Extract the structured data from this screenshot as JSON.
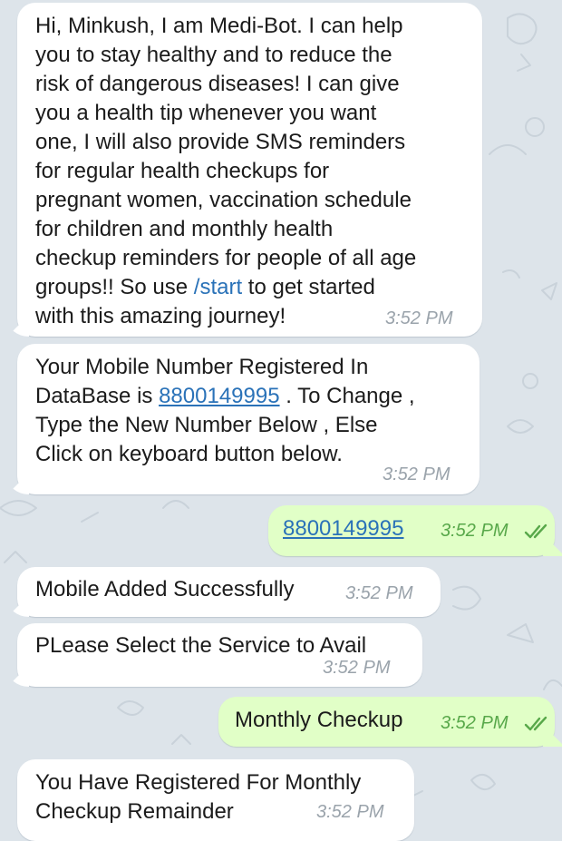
{
  "chat": {
    "messages": [
      {
        "direction": "incoming",
        "text_lines": [
          "Hi, Minkush, I am Medi-Bot. I can help",
          "you to stay healthy and to reduce the",
          "risk of dangerous diseases! I can give",
          "you a health tip whenever you want",
          "one, I will also provide SMS reminders",
          "for regular health checkups for",
          "pregnant women, vaccination schedule",
          "for children and monthly health",
          "checkup reminders for people of all age"
        ],
        "line10_before": "groups!! So use ",
        "command": "/start",
        "line10_after": " to get started",
        "line11": "with this amazing journey!",
        "time": "3:52 PM"
      },
      {
        "direction": "incoming",
        "line1": "Your Mobile Number Registered In",
        "line2_before": "DataBase is ",
        "phone": "8800149995",
        "line2_after": " . To Change ,",
        "line3": "Type the New Number Below , Else",
        "line4": "Click on keyboard button below.",
        "time": "3:52 PM"
      },
      {
        "direction": "outgoing",
        "phone": "8800149995",
        "time": "3:52 PM",
        "status": "read"
      },
      {
        "direction": "incoming",
        "text": "Mobile Added Successfully",
        "time": "3:52 PM"
      },
      {
        "direction": "incoming",
        "text": "PLease Select the Service to Avail",
        "time": "3:52 PM"
      },
      {
        "direction": "outgoing",
        "text": "Monthly Checkup",
        "time": "3:52 PM",
        "status": "read"
      },
      {
        "direction": "incoming",
        "line1": "You Have Registered For Monthly",
        "line2": "Checkup Remainder",
        "time": "3:52 PM"
      }
    ]
  },
  "colors": {
    "background": "#dde4ea",
    "incoming_bubble": "#ffffff",
    "outgoing_bubble": "#e1ffc7",
    "link": "#2a72b8",
    "outgoing_time": "#58a84a",
    "incoming_time": "#9aa3ab"
  },
  "icons": {
    "read_status": "double-check-icon",
    "background_pattern": "doodle-pattern"
  }
}
